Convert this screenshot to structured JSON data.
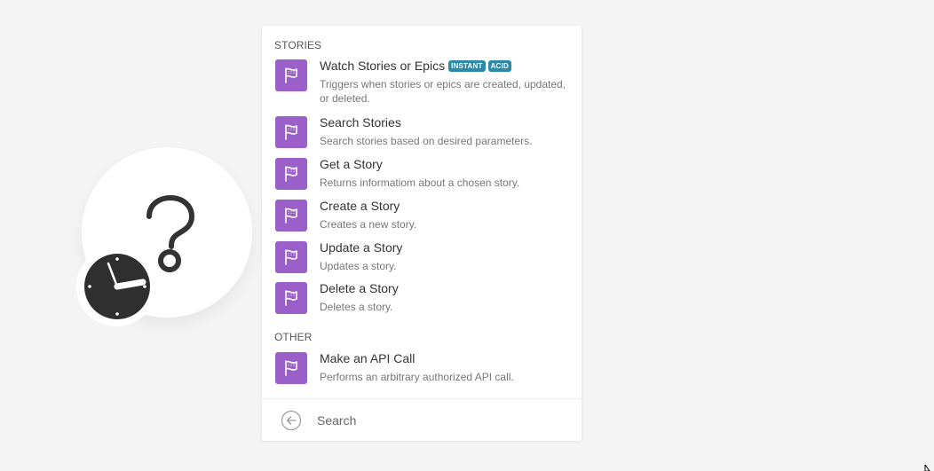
{
  "colors": {
    "module_icon_bg": "#9a5fc9",
    "badge_bg": "#2c89a8",
    "panel_bg": "#ffffff",
    "canvas_bg": "#f4f4f4"
  },
  "module": {
    "icon": "question-mark-icon",
    "badge_icon": "clock-icon"
  },
  "panel": {
    "sections": [
      {
        "header": "STORIES",
        "items": [
          {
            "title": "Watch Stories or Epics",
            "badges": [
              "INSTANT",
              "ACID"
            ],
            "description": "Triggers when stories or epics are created, updated, or deleted.",
            "icon": "flag-icon"
          },
          {
            "title": "Search Stories",
            "description": "Search stories based on desired parameters.",
            "icon": "flag-icon"
          },
          {
            "title": "Get a Story",
            "description": "Returns informatiom about a chosen story.",
            "icon": "flag-icon"
          },
          {
            "title": "Create a Story",
            "description": "Creates a new story.",
            "icon": "flag-icon"
          },
          {
            "title": "Update a Story",
            "description": "Updates a story.",
            "icon": "flag-icon"
          },
          {
            "title": "Delete a Story",
            "description": "Deletes a story.",
            "icon": "flag-icon"
          }
        ]
      },
      {
        "header": "OTHER",
        "items": [
          {
            "title": "Make an API Call",
            "description": "Performs an arbitrary authorized API call.",
            "icon": "flag-icon"
          }
        ]
      }
    ],
    "search": {
      "placeholder": "Search",
      "value": ""
    }
  }
}
